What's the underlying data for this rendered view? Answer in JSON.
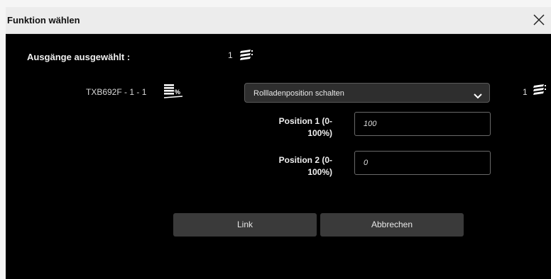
{
  "dialog": {
    "title": "Funktion wählen",
    "close_icon": "close-icon"
  },
  "selection": {
    "label": "Ausgänge ausgewählt :",
    "count": "1",
    "icon": "output-stack-icon"
  },
  "device": {
    "name": "TXB692F - 1 - 1",
    "icon": "shutter-percent-icon"
  },
  "function_select": {
    "value": "Rollladenposition schalten",
    "icon": "chevron-down-icon"
  },
  "right_count": {
    "count": "1",
    "icon": "output-stack-icon"
  },
  "positions": [
    {
      "label_line1": "Position 1 (0-",
      "label_line2": "100%)",
      "value": "100"
    },
    {
      "label_line1": "Position 2 (0-",
      "label_line2": "100%)",
      "value": "0"
    }
  ],
  "buttons": {
    "link": "Link",
    "cancel": "Abbrechen"
  },
  "colors": {
    "background": "#000000",
    "titlebar": "#ececec",
    "button": "#3a3a3a"
  }
}
